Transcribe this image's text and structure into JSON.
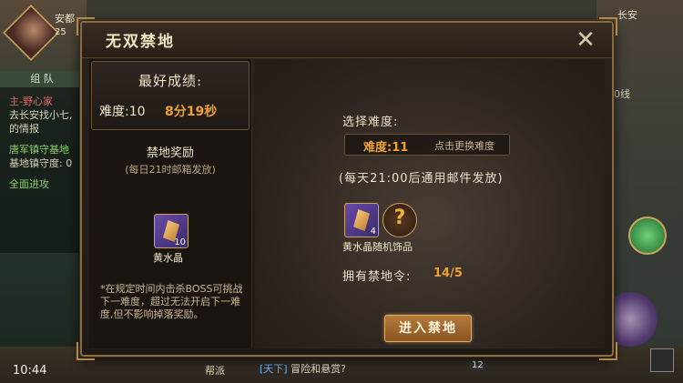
{
  "hud": {
    "player_name": "安都",
    "player_level": "25",
    "region": "长安",
    "line": "0线",
    "clock": "10:44",
    "guild_label": "帮派",
    "chat_tag": "[天下]",
    "chat_text": "冒险和悬赏?",
    "badge": "12"
  },
  "quests": {
    "tab": "组 队",
    "rows": [
      {
        "text": "主-野心家",
        "color": "#e06a6a"
      },
      {
        "text": "去长安找小七,",
        "color": "#d8d0b8"
      },
      {
        "text": "的情报",
        "color": "#d8d0b8"
      },
      {
        "text": "唐军镇守基地",
        "color": "#8ad06a"
      },
      {
        "text": "基地镇守度: 0",
        "color": "#d8d0b8"
      },
      {
        "text": "全面进攻",
        "color": "#8ad06a"
      }
    ]
  },
  "dialog": {
    "title": "无双禁地",
    "best": {
      "title": "最好成绩:",
      "difficulty": "难度:10",
      "time": "8分19秒"
    },
    "reward": {
      "title": "禁地奖励",
      "subtitle": "(每日21时邮箱发放)",
      "item_name": "黄水晶",
      "item_count": "10"
    },
    "rule": "*在规定时间内击杀BOSS可挑战下一难度，超过无法开启下一难度,但不影响掉落奖励。",
    "select": {
      "label": "选择难度:",
      "value": "难度:11",
      "hint": "点击更换难度"
    },
    "daily_note": "(每天21:00后通用邮件发放)",
    "rewards_right": {
      "item1_count": "4",
      "item2_symbol": "?",
      "names": "黄水晶随机饰品"
    },
    "tokens": {
      "label": "拥有禁地令:",
      "value": "14/5"
    },
    "enter_button": "进入禁地",
    "close_symbol": "✕"
  },
  "colors": {
    "accent_orange": "#f0a030",
    "border_gold": "#c9a45a"
  }
}
